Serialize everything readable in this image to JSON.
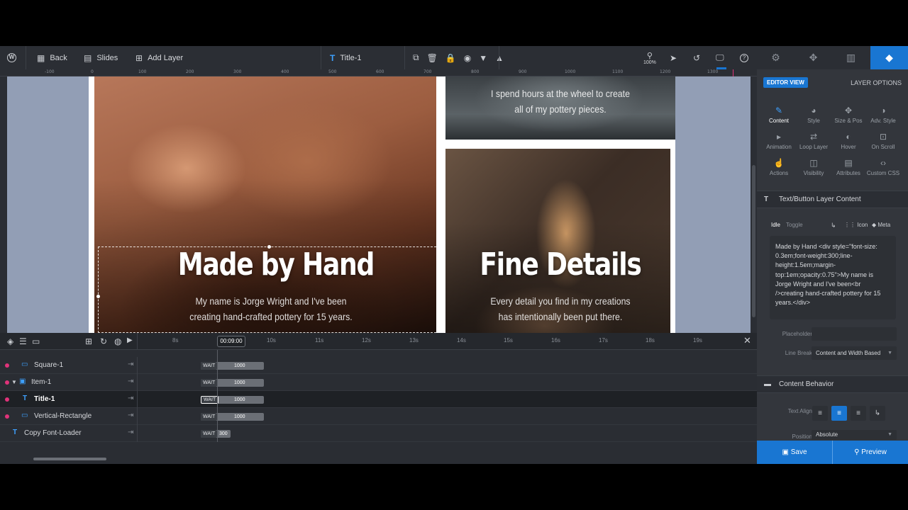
{
  "toolbar": {
    "back_label": "Back",
    "slides_label": "Slides",
    "add_layer_label": "Add Layer",
    "layer_name": "Title-1",
    "zoom_label": "100%"
  },
  "ruler": {
    "ticks": [
      "-100",
      "0",
      "100",
      "200",
      "300",
      "400",
      "500",
      "600",
      "700",
      "800",
      "900",
      "1000",
      "1100",
      "1200",
      "1300"
    ]
  },
  "slide": {
    "panel1": {
      "headline": "Made by Hand",
      "sub_line1": "My name is Jorge Wright and I've been",
      "sub_line2": "creating hand-crafted pottery for 15 years."
    },
    "panel2": {
      "sub_line1": "I spend hours at the wheel to create",
      "sub_line2": "all of my pottery pieces."
    },
    "panel3": {
      "headline": "Fine Details",
      "sub_line1": "Every detail you find in my creations",
      "sub_line2": "has intentionally been put there."
    }
  },
  "timeline": {
    "current_time": "00:09:00",
    "ticks": [
      "8s",
      "10s",
      "11s",
      "12s",
      "13s",
      "14s",
      "15s",
      "16s",
      "17s",
      "18s",
      "19s"
    ],
    "rows": [
      {
        "label": "Square-1",
        "wait": "WAIT",
        "duration": "1000"
      },
      {
        "label": "Item-1",
        "wait": "WAIT",
        "duration": "1000"
      },
      {
        "label": "Title-1",
        "wait": "WAIT",
        "duration": "1000"
      },
      {
        "label": "Vertical-Rectangle",
        "wait": "WAIT",
        "duration": "1000"
      },
      {
        "label": "Copy Font-Loader",
        "wait": "WAIT",
        "duration": "300"
      }
    ]
  },
  "panel": {
    "editor_view": "EDITOR VIEW",
    "layer_options": "LAYER OPTIONS",
    "tabs": [
      {
        "label": "Content"
      },
      {
        "label": "Style"
      },
      {
        "label": "Size & Pos"
      },
      {
        "label": "Adv. Style"
      },
      {
        "label": "Animation"
      },
      {
        "label": "Loop Layer"
      },
      {
        "label": "Hover"
      },
      {
        "label": "On Scroll"
      },
      {
        "label": "Actions"
      },
      {
        "label": "Visibility"
      },
      {
        "label": "Attributes"
      },
      {
        "label": "Custom CSS"
      }
    ],
    "content_section": "Text/Button Layer Content",
    "idle_label": "Idle",
    "toggle_label": "Toggle",
    "icon_label": "Icon",
    "meta_label": "Meta",
    "content_text": "Made by Hand\n<div style=\"font-size: 0.3em;font-weight:300;line-height:1.5em;margin-top:1em;opacity:0.75\">My name is Jorge Wright and I've been<br />creating hand-crafted pottery for 15 years.</div>",
    "placeholder_label": "Placeholder",
    "placeholder_value": "",
    "line_break_label": "Line Break",
    "line_break_value": "Content and Width Based",
    "behavior_section": "Content Behavior",
    "text_align_label": "Text Align",
    "position_label": "Position",
    "position_value": "Absolute",
    "save_label": "Save",
    "preview_label": "Preview"
  },
  "colors": {
    "accent": "#1976d2",
    "layer_dot": "#e0337a"
  }
}
